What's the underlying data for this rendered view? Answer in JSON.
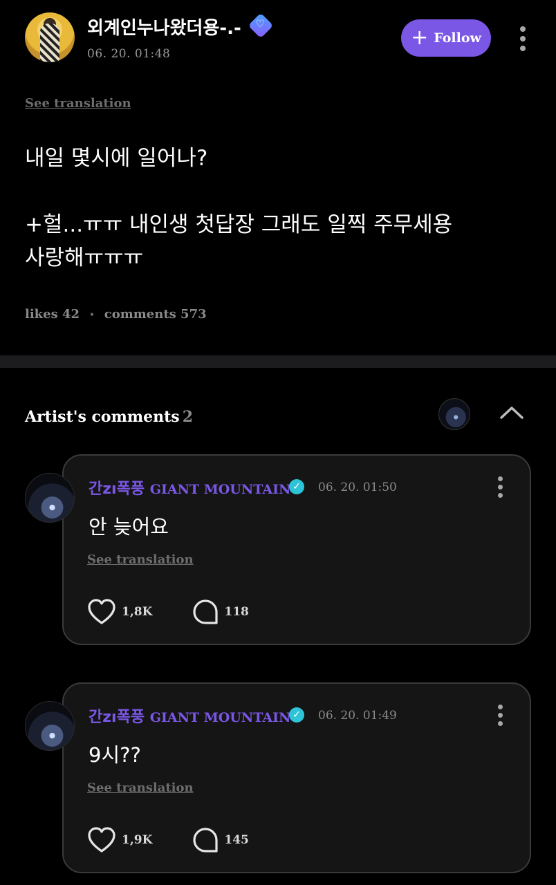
{
  "post": {
    "author": "외계인누나왔더용-.-",
    "verified_icon": "heart-badge-icon",
    "date": "06. 20. 01:48",
    "follow_label": "Follow",
    "see_translation": "See translation",
    "body": "내일 몇시에 일어나?\n\n+헐...ㅠㅠ 내인생 첫답장 그래도 일찍 주무세용\n사랑해ㅠㅠㅠ",
    "likes_label": "likes 42",
    "comments_label": "comments 573"
  },
  "artist_comments": {
    "title": "Artist's comments",
    "count": "2",
    "items": [
      {
        "author_ko": "간zı폭풍",
        "author_latin": "GIANT MOUNTAIN",
        "date": "06. 20. 01:50",
        "text": "안 늦어요",
        "see_translation": "See translation",
        "likes": "1,8K",
        "replies": "118"
      },
      {
        "author_ko": "간zı폭풍",
        "author_latin": "GIANT MOUNTAIN",
        "date": "06. 20. 01:49",
        "text": "9시??",
        "see_translation": "See translation",
        "likes": "1,9K",
        "replies": "145"
      }
    ]
  },
  "colors": {
    "accent": "#7b57e6",
    "verified": "#2ec4d8",
    "background": "#000000",
    "card": "#151515"
  }
}
